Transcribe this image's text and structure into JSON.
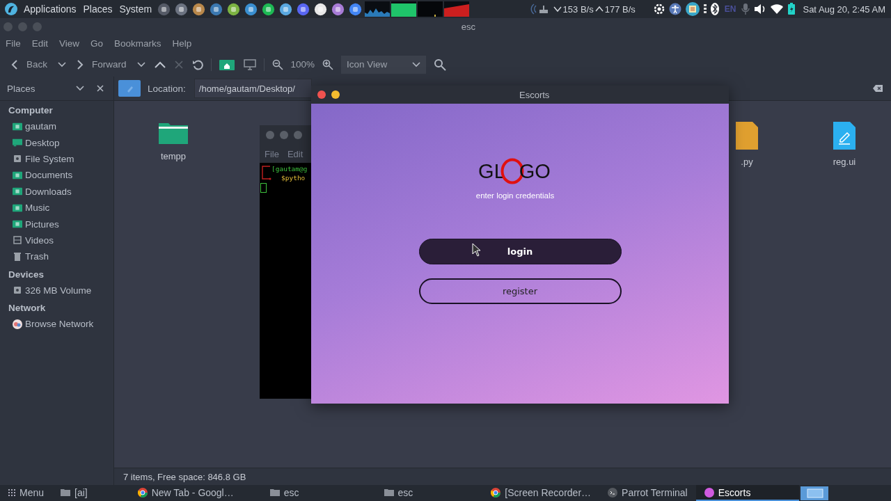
{
  "top_panel": {
    "menus": [
      "Applications",
      "Places",
      "System"
    ],
    "net_down": "153 B/s",
    "net_up": "177 B/s",
    "language": "EN",
    "clock": "Sat Aug 20,  2:45 AM"
  },
  "file_manager": {
    "title": "esc",
    "menu": [
      "File",
      "Edit",
      "View",
      "Go",
      "Bookmarks",
      "Help"
    ],
    "toolbar": {
      "back": "Back",
      "forward": "Forward",
      "zoom": "100%",
      "view_mode": "Icon View"
    },
    "sidebar": {
      "title": "Places",
      "sections": [
        {
          "label": "Computer",
          "children": [
            {
              "label": "gautam",
              "kind": "home"
            },
            {
              "label": "Desktop",
              "kind": "desktop"
            },
            {
              "label": "File System",
              "kind": "drive"
            },
            {
              "label": "Documents",
              "kind": "folder"
            },
            {
              "label": "Downloads",
              "kind": "folder"
            },
            {
              "label": "Music",
              "kind": "folder"
            },
            {
              "label": "Pictures",
              "kind": "folder"
            },
            {
              "label": "Videos",
              "kind": "film"
            },
            {
              "label": "Trash",
              "kind": "trash"
            }
          ]
        },
        {
          "label": "Devices",
          "children": [
            {
              "label": "326 MB Volume",
              "kind": "drive"
            }
          ]
        },
        {
          "label": "Network",
          "children": [
            {
              "label": "Browse Network",
              "kind": "network"
            }
          ]
        }
      ]
    },
    "location_label": "Location:",
    "location": "/home/gautam/Desktop/",
    "files_left": [
      {
        "label": "tempp",
        "kind": "folder"
      }
    ],
    "files_right": [
      {
        "label": ".py",
        "kind": "python"
      },
      {
        "label": "reg.ui",
        "kind": "ui"
      }
    ],
    "status": "7 items, Free space: 846.8 GB"
  },
  "terminal": {
    "menu": [
      "File",
      "Edit"
    ],
    "prompt": "[gautam@g",
    "command": "$pytho"
  },
  "dialog": {
    "title": "Escorts",
    "logo_left": "GL",
    "logo_right": "GO",
    "subtitle": "enter login credentials",
    "buttons": [
      {
        "label": "login",
        "kind": "filled"
      },
      {
        "label": "register",
        "kind": "outline"
      }
    ]
  },
  "taskbar": [
    {
      "label": "Menu",
      "kind": "menu",
      "selected": false
    },
    {
      "label": "[ai]",
      "kind": "folder",
      "selected": false
    },
    {
      "label": "New Tab - Googl…",
      "kind": "browser",
      "selected": false
    },
    {
      "label": "esc",
      "kind": "folder",
      "selected": false
    },
    {
      "label": "esc",
      "kind": "folder",
      "selected": false
    },
    {
      "label": "[Screen Recorder…",
      "kind": "browser",
      "selected": false
    },
    {
      "label": "Parrot Terminal",
      "kind": "terminal",
      "selected": false
    },
    {
      "label": "Escorts",
      "kind": "app",
      "selected": true
    }
  ]
}
